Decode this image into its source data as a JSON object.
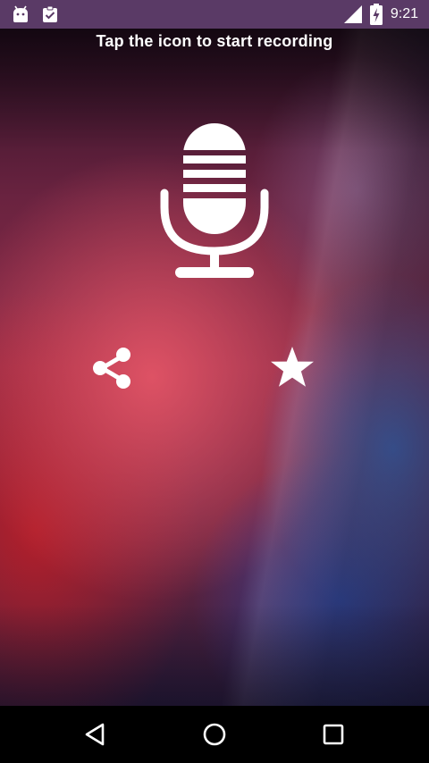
{
  "status_bar": {
    "time": "9:21",
    "left_icons": [
      "android-debug-icon",
      "clipboard-check-icon"
    ],
    "right_icons": [
      "signal-icon",
      "battery-charging-icon"
    ]
  },
  "main": {
    "instruction": "Tap the icon to start recording",
    "mic_icon": "microphone-icon",
    "share_icon": "share-icon",
    "favorite_icon": "star-icon"
  },
  "nav_bar": {
    "buttons": [
      "back-icon",
      "home-icon",
      "recents-icon"
    ]
  },
  "colors": {
    "status_bar": "#5a3a66",
    "icon": "#ffffff",
    "nav_bar": "#000000"
  }
}
